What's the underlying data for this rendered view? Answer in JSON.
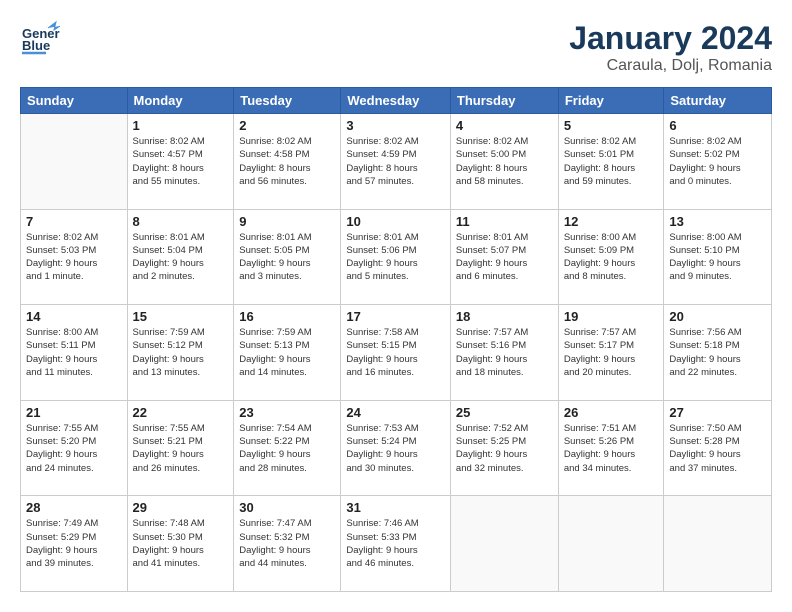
{
  "header": {
    "logo_line1": "General",
    "logo_line2": "Blue",
    "title": "January 2024",
    "subtitle": "Caraula, Dolj, Romania"
  },
  "days_of_week": [
    "Sunday",
    "Monday",
    "Tuesday",
    "Wednesday",
    "Thursday",
    "Friday",
    "Saturday"
  ],
  "weeks": [
    [
      {
        "day": "",
        "info": ""
      },
      {
        "day": "1",
        "info": "Sunrise: 8:02 AM\nSunset: 4:57 PM\nDaylight: 8 hours\nand 55 minutes."
      },
      {
        "day": "2",
        "info": "Sunrise: 8:02 AM\nSunset: 4:58 PM\nDaylight: 8 hours\nand 56 minutes."
      },
      {
        "day": "3",
        "info": "Sunrise: 8:02 AM\nSunset: 4:59 PM\nDaylight: 8 hours\nand 57 minutes."
      },
      {
        "day": "4",
        "info": "Sunrise: 8:02 AM\nSunset: 5:00 PM\nDaylight: 8 hours\nand 58 minutes."
      },
      {
        "day": "5",
        "info": "Sunrise: 8:02 AM\nSunset: 5:01 PM\nDaylight: 8 hours\nand 59 minutes."
      },
      {
        "day": "6",
        "info": "Sunrise: 8:02 AM\nSunset: 5:02 PM\nDaylight: 9 hours\nand 0 minutes."
      }
    ],
    [
      {
        "day": "7",
        "info": "Sunrise: 8:02 AM\nSunset: 5:03 PM\nDaylight: 9 hours\nand 1 minute."
      },
      {
        "day": "8",
        "info": "Sunrise: 8:01 AM\nSunset: 5:04 PM\nDaylight: 9 hours\nand 2 minutes."
      },
      {
        "day": "9",
        "info": "Sunrise: 8:01 AM\nSunset: 5:05 PM\nDaylight: 9 hours\nand 3 minutes."
      },
      {
        "day": "10",
        "info": "Sunrise: 8:01 AM\nSunset: 5:06 PM\nDaylight: 9 hours\nand 5 minutes."
      },
      {
        "day": "11",
        "info": "Sunrise: 8:01 AM\nSunset: 5:07 PM\nDaylight: 9 hours\nand 6 minutes."
      },
      {
        "day": "12",
        "info": "Sunrise: 8:00 AM\nSunset: 5:09 PM\nDaylight: 9 hours\nand 8 minutes."
      },
      {
        "day": "13",
        "info": "Sunrise: 8:00 AM\nSunset: 5:10 PM\nDaylight: 9 hours\nand 9 minutes."
      }
    ],
    [
      {
        "day": "14",
        "info": "Sunrise: 8:00 AM\nSunset: 5:11 PM\nDaylight: 9 hours\nand 11 minutes."
      },
      {
        "day": "15",
        "info": "Sunrise: 7:59 AM\nSunset: 5:12 PM\nDaylight: 9 hours\nand 13 minutes."
      },
      {
        "day": "16",
        "info": "Sunrise: 7:59 AM\nSunset: 5:13 PM\nDaylight: 9 hours\nand 14 minutes."
      },
      {
        "day": "17",
        "info": "Sunrise: 7:58 AM\nSunset: 5:15 PM\nDaylight: 9 hours\nand 16 minutes."
      },
      {
        "day": "18",
        "info": "Sunrise: 7:57 AM\nSunset: 5:16 PM\nDaylight: 9 hours\nand 18 minutes."
      },
      {
        "day": "19",
        "info": "Sunrise: 7:57 AM\nSunset: 5:17 PM\nDaylight: 9 hours\nand 20 minutes."
      },
      {
        "day": "20",
        "info": "Sunrise: 7:56 AM\nSunset: 5:18 PM\nDaylight: 9 hours\nand 22 minutes."
      }
    ],
    [
      {
        "day": "21",
        "info": "Sunrise: 7:55 AM\nSunset: 5:20 PM\nDaylight: 9 hours\nand 24 minutes."
      },
      {
        "day": "22",
        "info": "Sunrise: 7:55 AM\nSunset: 5:21 PM\nDaylight: 9 hours\nand 26 minutes."
      },
      {
        "day": "23",
        "info": "Sunrise: 7:54 AM\nSunset: 5:22 PM\nDaylight: 9 hours\nand 28 minutes."
      },
      {
        "day": "24",
        "info": "Sunrise: 7:53 AM\nSunset: 5:24 PM\nDaylight: 9 hours\nand 30 minutes."
      },
      {
        "day": "25",
        "info": "Sunrise: 7:52 AM\nSunset: 5:25 PM\nDaylight: 9 hours\nand 32 minutes."
      },
      {
        "day": "26",
        "info": "Sunrise: 7:51 AM\nSunset: 5:26 PM\nDaylight: 9 hours\nand 34 minutes."
      },
      {
        "day": "27",
        "info": "Sunrise: 7:50 AM\nSunset: 5:28 PM\nDaylight: 9 hours\nand 37 minutes."
      }
    ],
    [
      {
        "day": "28",
        "info": "Sunrise: 7:49 AM\nSunset: 5:29 PM\nDaylight: 9 hours\nand 39 minutes."
      },
      {
        "day": "29",
        "info": "Sunrise: 7:48 AM\nSunset: 5:30 PM\nDaylight: 9 hours\nand 41 minutes."
      },
      {
        "day": "30",
        "info": "Sunrise: 7:47 AM\nSunset: 5:32 PM\nDaylight: 9 hours\nand 44 minutes."
      },
      {
        "day": "31",
        "info": "Sunrise: 7:46 AM\nSunset: 5:33 PM\nDaylight: 9 hours\nand 46 minutes."
      },
      {
        "day": "",
        "info": ""
      },
      {
        "day": "",
        "info": ""
      },
      {
        "day": "",
        "info": ""
      }
    ]
  ]
}
